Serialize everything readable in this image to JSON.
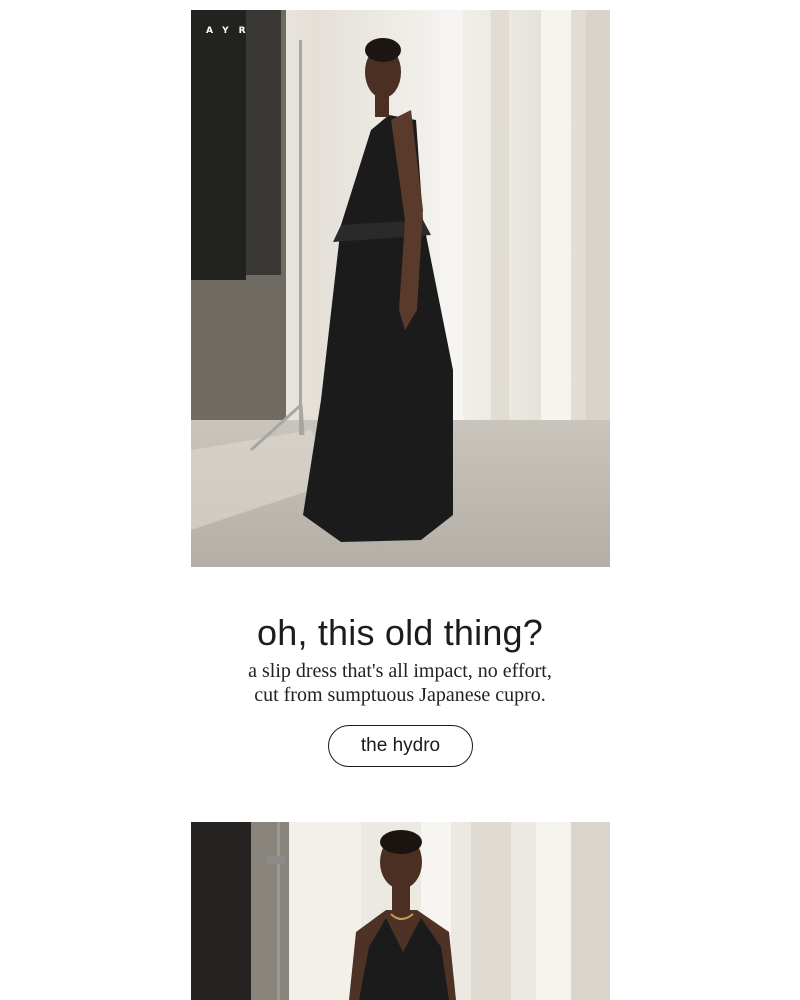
{
  "brand": {
    "logo_text": "AYR"
  },
  "hero": {
    "image_label": "model wearing black maxi slip dress in studio"
  },
  "promo": {
    "headline": "oh, this old thing?",
    "body_line1": "a slip dress that's all impact, no effort,",
    "body_line2": "cut from sumptuous Japanese cupro.",
    "cta_label": "the hydro"
  },
  "second_image": {
    "image_label": "model in black slip dress, front view"
  },
  "colors": {
    "text": "#1c1c1c",
    "background": "#ffffff",
    "dress": "#1b1b1b"
  }
}
